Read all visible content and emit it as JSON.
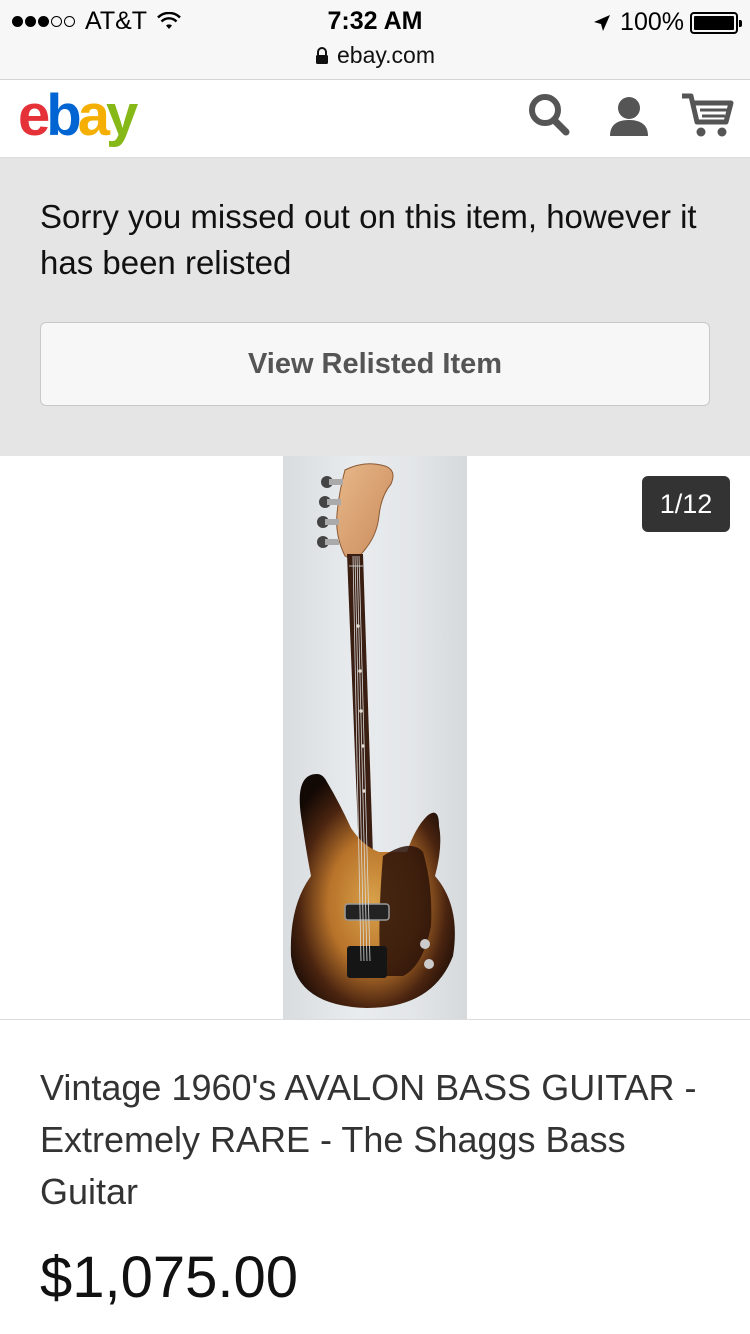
{
  "status_bar": {
    "signal_bars_filled": 3,
    "signal_bars_total": 5,
    "carrier": "AT&T",
    "time": "7:32 AM",
    "battery": "100%",
    "battery_level": 1.0
  },
  "url_bar": {
    "domain": "ebay.com"
  },
  "header": {
    "logo_letters": [
      "e",
      "b",
      "a",
      "y"
    ],
    "logo_colors": [
      "#e53238",
      "#0064d2",
      "#f5af02",
      "#86b817"
    ],
    "icons": [
      "search-icon",
      "account-icon",
      "cart-icon"
    ]
  },
  "banner": {
    "message": "Sorry you missed out on this item, however it has been relisted",
    "button_label": "View Relisted Item"
  },
  "gallery": {
    "counter": "1/12"
  },
  "item": {
    "title": "Vintage 1960's AVALON BASS GUITAR - Extremely RARE - The Shaggs Bass Guitar",
    "price": "$1,075.00"
  }
}
